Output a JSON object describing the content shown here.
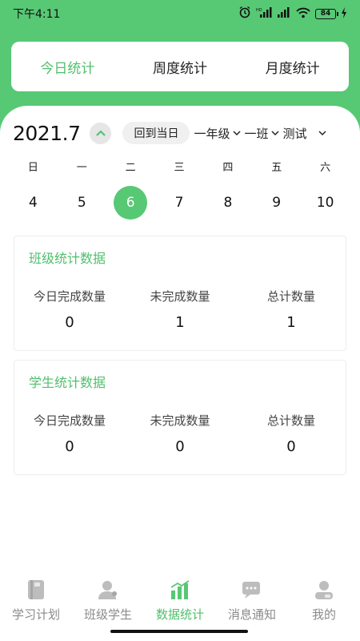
{
  "status_bar": {
    "time": "下午4:11",
    "battery": "84"
  },
  "tabs": [
    {
      "label": "今日统计",
      "active": true
    },
    {
      "label": "周度统计",
      "active": false
    },
    {
      "label": "月度统计",
      "active": false
    }
  ],
  "calendar": {
    "year_month": "2021.7",
    "today_button": "回到当日",
    "grade": "一年级",
    "class": "一班",
    "test": "测试",
    "weekdays": [
      "日",
      "一",
      "二",
      "三",
      "四",
      "五",
      "六"
    ],
    "days": [
      "4",
      "5",
      "6",
      "7",
      "8",
      "9",
      "10"
    ],
    "selected_day": "6"
  },
  "class_stats": {
    "title": "班级统计数据",
    "items": [
      {
        "label": "今日完成数量",
        "value": "0"
      },
      {
        "label": "未完成数量",
        "value": "1"
      },
      {
        "label": "总计数量",
        "value": "1"
      }
    ]
  },
  "student_stats": {
    "title": "学生统计数据",
    "items": [
      {
        "label": "今日完成数量",
        "value": "0"
      },
      {
        "label": "未完成数量",
        "value": "0"
      },
      {
        "label": "总计数量",
        "value": "0"
      }
    ]
  },
  "bottom_nav": [
    {
      "label": "学习计划",
      "icon": "book-icon",
      "active": false
    },
    {
      "label": "班级学生",
      "icon": "person-icon",
      "active": false
    },
    {
      "label": "数据统计",
      "icon": "bar-chart-icon",
      "active": true
    },
    {
      "label": "消息通知",
      "icon": "message-icon",
      "active": false
    },
    {
      "label": "我的",
      "icon": "profile-icon",
      "active": false
    }
  ],
  "colors": {
    "accent": "#57c874",
    "accent_text": "#4fbf6c",
    "inactive": "#8a8a8a"
  }
}
